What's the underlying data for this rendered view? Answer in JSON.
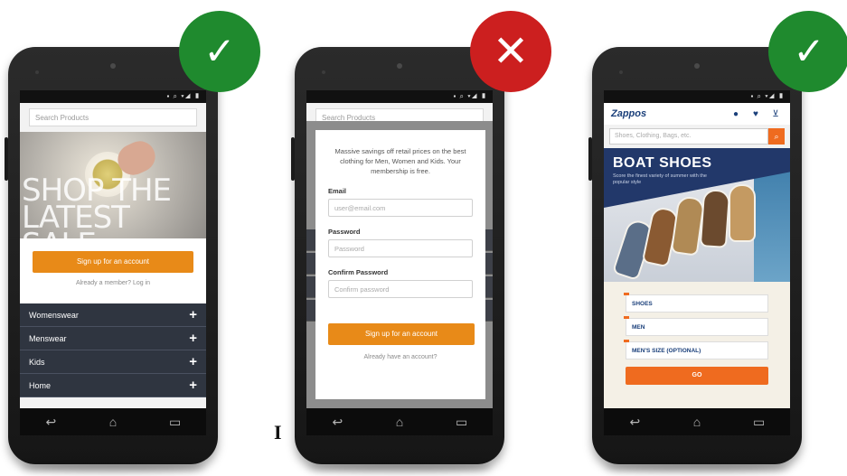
{
  "phone1": {
    "search_placeholder": "Search Products",
    "hero_text_line1": "SHOP THE",
    "hero_text_line2": "LATEST SALE",
    "signup_button": "Sign up for an account",
    "login_link": "Already a member? Log in",
    "categories": [
      {
        "label": "Womenswear"
      },
      {
        "label": "Menswear"
      },
      {
        "label": "Kids"
      },
      {
        "label": "Home"
      }
    ],
    "badge_icon": "check-icon",
    "badge_color": "#1f8a2e"
  },
  "phone2": {
    "search_placeholder": "Search Products",
    "intro": "Massive savings off retail prices on the best clothing for Men, Women and Kids. Your membership is free.",
    "email_label": "Email",
    "email_placeholder": "user@email.com",
    "password_label": "Password",
    "password_placeholder": "Password",
    "confirm_label": "Confirm Password",
    "confirm_placeholder": "Confirm password",
    "signup_button": "Sign up for an account",
    "login_link": "Already have an account?",
    "badge_icon": "cross-icon",
    "badge_color": "#cc1f1f"
  },
  "phone3": {
    "logo": "Zappos",
    "search_placeholder": "Shoes, Clothing, Bags, etc.",
    "banner_title": "BOAT SHOES",
    "banner_sub": "Score the finest variety of summer with the popular style",
    "selects": [
      "SHOES",
      "MEN",
      "MEN'S SIZE (OPTIONAL)"
    ],
    "go_button": "GO",
    "badge_icon": "check-icon",
    "badge_color": "#1f8a2e"
  },
  "nav_icons": [
    "back-icon",
    "home-icon",
    "recents-icon"
  ],
  "stray_text": "I"
}
